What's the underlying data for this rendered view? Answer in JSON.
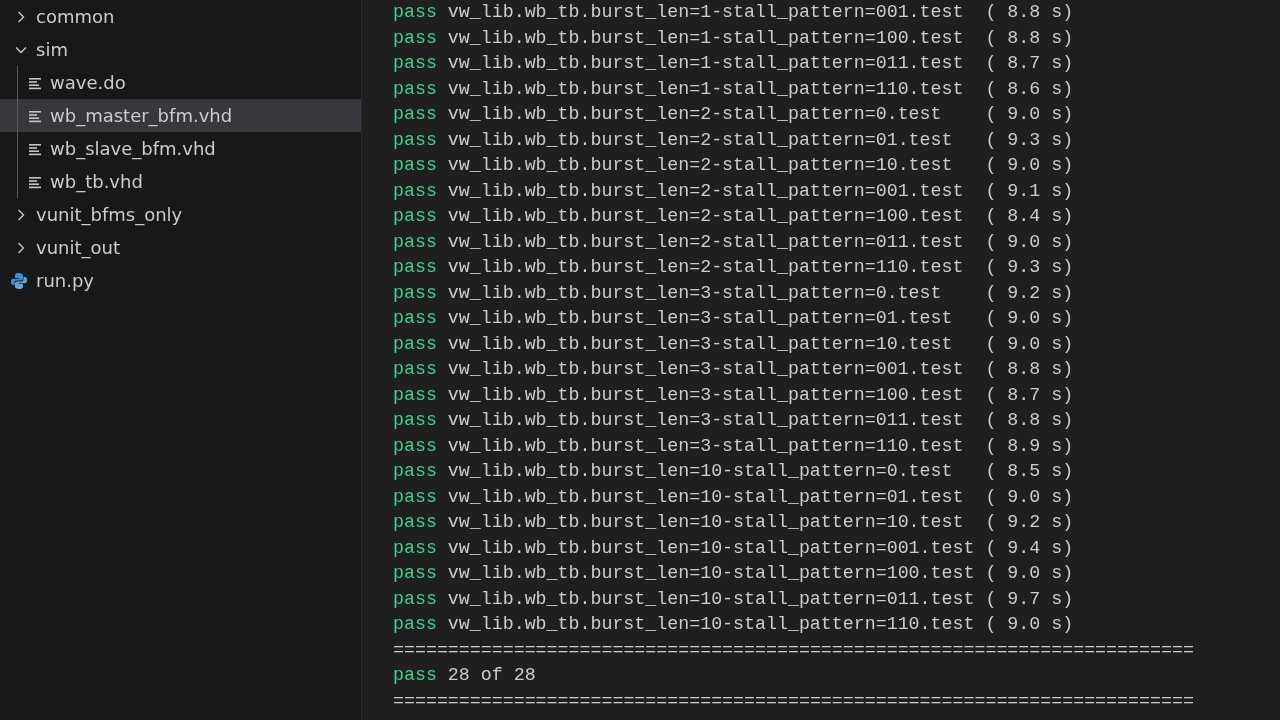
{
  "explorer": {
    "items": [
      {
        "kind": "folder",
        "label": "common",
        "expanded": false,
        "selected": false
      },
      {
        "kind": "folder",
        "label": "sim",
        "expanded": true,
        "selected": false,
        "children": [
          {
            "kind": "text_file",
            "label": "wave.do",
            "selected": false
          },
          {
            "kind": "text_file",
            "label": "wb_master_bfm.vhd",
            "selected": true
          },
          {
            "kind": "text_file",
            "label": "wb_slave_bfm.vhd",
            "selected": false
          },
          {
            "kind": "text_file",
            "label": "wb_tb.vhd",
            "selected": false
          }
        ]
      },
      {
        "kind": "folder",
        "label": "vunit_bfms_only",
        "expanded": false,
        "selected": false
      },
      {
        "kind": "folder",
        "label": "vunit_out",
        "expanded": false,
        "selected": false
      },
      {
        "kind": "python_file",
        "label": "run.py",
        "selected": false
      }
    ]
  },
  "terminal": {
    "results": [
      {
        "status": "pass",
        "name": "vw_lib.wb_tb.burst_len=1-stall_pattern=001.test",
        "time": "( 8.8 s)"
      },
      {
        "status": "pass",
        "name": "vw_lib.wb_tb.burst_len=1-stall_pattern=100.test",
        "time": "( 8.8 s)"
      },
      {
        "status": "pass",
        "name": "vw_lib.wb_tb.burst_len=1-stall_pattern=011.test",
        "time": "( 8.7 s)"
      },
      {
        "status": "pass",
        "name": "vw_lib.wb_tb.burst_len=1-stall_pattern=110.test",
        "time": "( 8.6 s)"
      },
      {
        "status": "pass",
        "name": "vw_lib.wb_tb.burst_len=2-stall_pattern=0.test",
        "time": "( 9.0 s)"
      },
      {
        "status": "pass",
        "name": "vw_lib.wb_tb.burst_len=2-stall_pattern=01.test",
        "time": "( 9.3 s)"
      },
      {
        "status": "pass",
        "name": "vw_lib.wb_tb.burst_len=2-stall_pattern=10.test",
        "time": "( 9.0 s)"
      },
      {
        "status": "pass",
        "name": "vw_lib.wb_tb.burst_len=2-stall_pattern=001.test",
        "time": "( 9.1 s)"
      },
      {
        "status": "pass",
        "name": "vw_lib.wb_tb.burst_len=2-stall_pattern=100.test",
        "time": "( 8.4 s)"
      },
      {
        "status": "pass",
        "name": "vw_lib.wb_tb.burst_len=2-stall_pattern=011.test",
        "time": "( 9.0 s)"
      },
      {
        "status": "pass",
        "name": "vw_lib.wb_tb.burst_len=2-stall_pattern=110.test",
        "time": "( 9.3 s)"
      },
      {
        "status": "pass",
        "name": "vw_lib.wb_tb.burst_len=3-stall_pattern=0.test",
        "time": "( 9.2 s)"
      },
      {
        "status": "pass",
        "name": "vw_lib.wb_tb.burst_len=3-stall_pattern=01.test",
        "time": "( 9.0 s)"
      },
      {
        "status": "pass",
        "name": "vw_lib.wb_tb.burst_len=3-stall_pattern=10.test",
        "time": "( 9.0 s)"
      },
      {
        "status": "pass",
        "name": "vw_lib.wb_tb.burst_len=3-stall_pattern=001.test",
        "time": "( 8.8 s)"
      },
      {
        "status": "pass",
        "name": "vw_lib.wb_tb.burst_len=3-stall_pattern=100.test",
        "time": "( 8.7 s)"
      },
      {
        "status": "pass",
        "name": "vw_lib.wb_tb.burst_len=3-stall_pattern=011.test",
        "time": "( 8.8 s)"
      },
      {
        "status": "pass",
        "name": "vw_lib.wb_tb.burst_len=3-stall_pattern=110.test",
        "time": "( 8.9 s)"
      },
      {
        "status": "pass",
        "name": "vw_lib.wb_tb.burst_len=10-stall_pattern=0.test",
        "time": "( 8.5 s)"
      },
      {
        "status": "pass",
        "name": "vw_lib.wb_tb.burst_len=10-stall_pattern=01.test",
        "time": "( 9.0 s)"
      },
      {
        "status": "pass",
        "name": "vw_lib.wb_tb.burst_len=10-stall_pattern=10.test",
        "time": "( 9.2 s)"
      },
      {
        "status": "pass",
        "name": "vw_lib.wb_tb.burst_len=10-stall_pattern=001.test",
        "time": "( 9.4 s)"
      },
      {
        "status": "pass",
        "name": "vw_lib.wb_tb.burst_len=10-stall_pattern=100.test",
        "time": "( 9.0 s)"
      },
      {
        "status": "pass",
        "name": "vw_lib.wb_tb.burst_len=10-stall_pattern=011.test",
        "time": "( 9.7 s)"
      },
      {
        "status": "pass",
        "name": "vw_lib.wb_tb.burst_len=10-stall_pattern=110.test",
        "time": "( 9.0 s)"
      }
    ],
    "separator_top": "=========================================================================",
    "summary": {
      "status": "pass",
      "text": "28 of 28"
    },
    "separator_bottom": "========================================================================="
  }
}
